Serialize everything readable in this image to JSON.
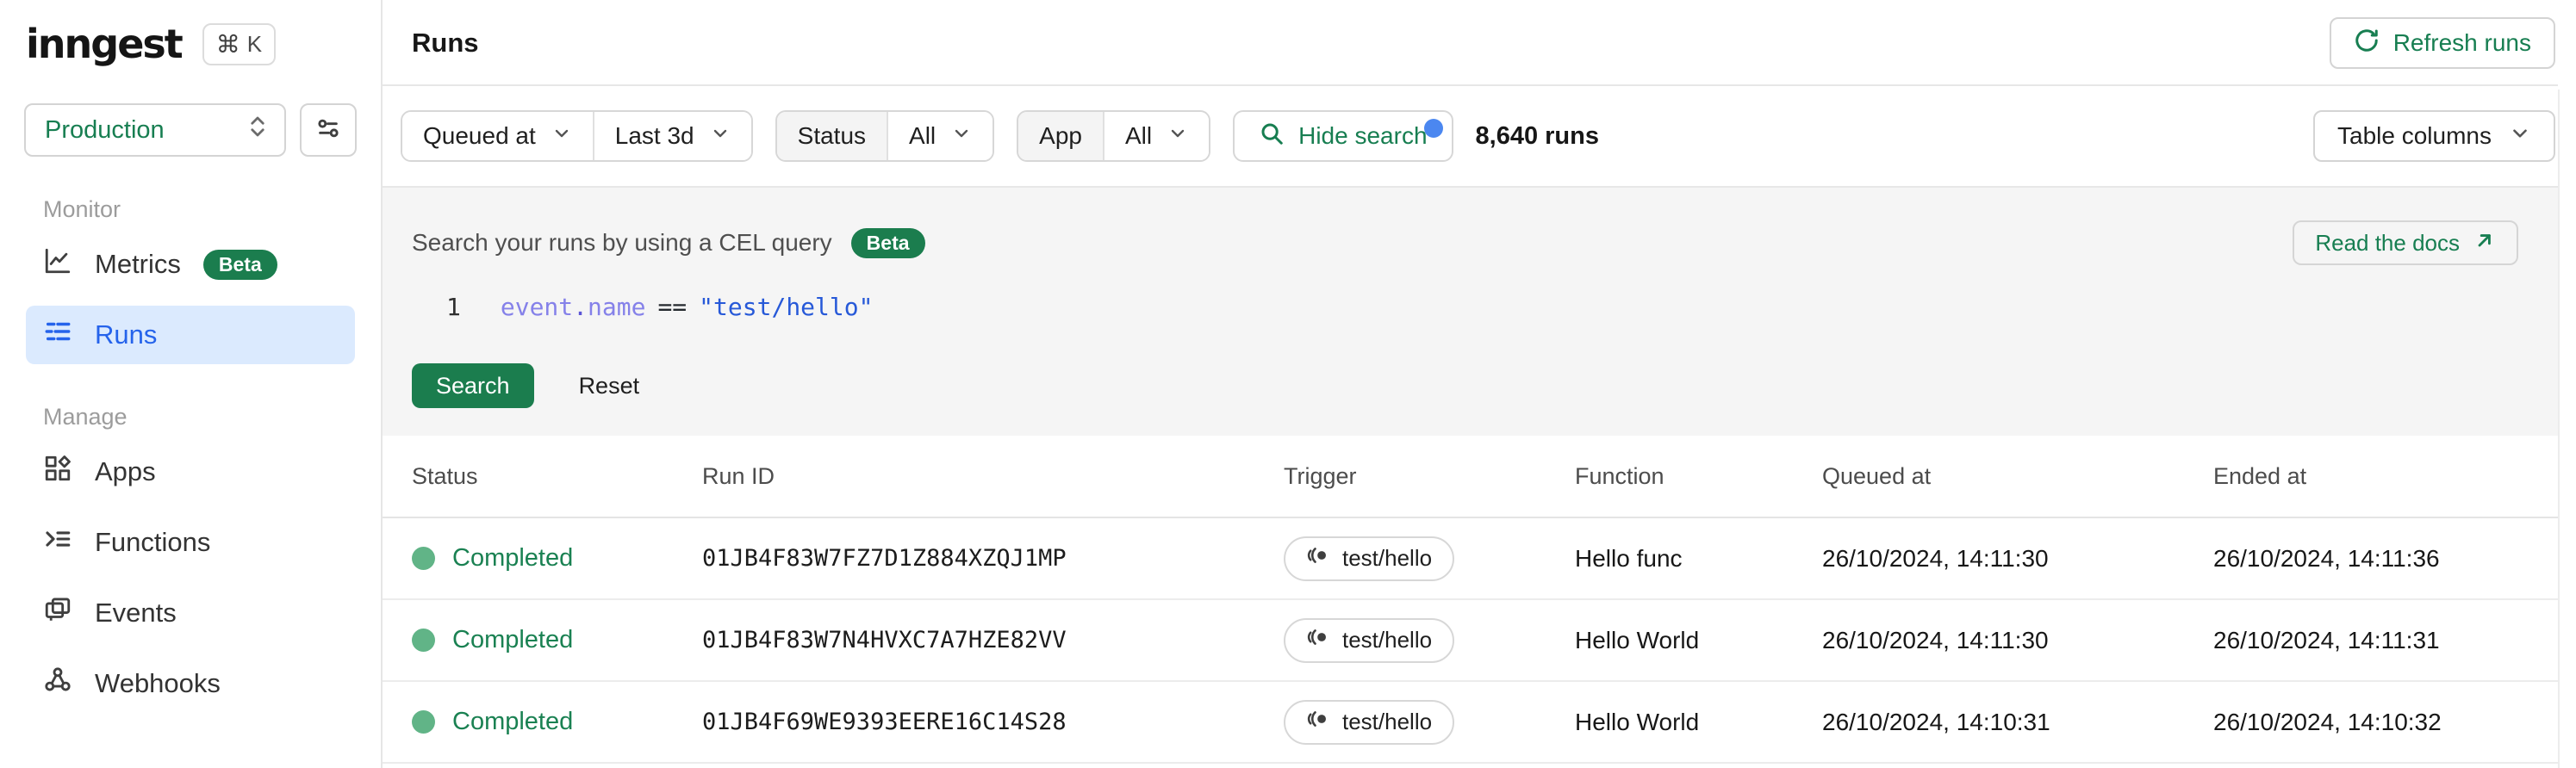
{
  "sidebar": {
    "logo": "inngest",
    "kbd": {
      "modifier": "⌘",
      "key": "K"
    },
    "env_selector": {
      "value": "Production"
    },
    "sections": [
      {
        "label": "Monitor",
        "items": [
          {
            "label": "Metrics",
            "badge": "Beta"
          },
          {
            "label": "Runs"
          }
        ]
      },
      {
        "label": "Manage",
        "items": [
          {
            "label": "Apps"
          },
          {
            "label": "Functions"
          },
          {
            "label": "Events"
          },
          {
            "label": "Webhooks"
          }
        ]
      }
    ]
  },
  "header": {
    "title": "Runs",
    "refresh_label": "Refresh runs"
  },
  "filters": {
    "time_field": "Queued at",
    "time_range": "Last 3d",
    "status_label": "Status",
    "status_value": "All",
    "app_label": "App",
    "app_value": "All",
    "search_toggle_label": "Hide search",
    "runs_count": "8,640 runs",
    "table_columns_label": "Table columns"
  },
  "search_panel": {
    "title": "Search your runs by using a CEL query",
    "beta_badge": "Beta",
    "docs_link": "Read the docs",
    "editor": {
      "line_number": "1",
      "ident1": "event",
      "dot": ".",
      "ident2": "name",
      "operator": "==",
      "string": "\"test/hello\""
    },
    "search_button": "Search",
    "reset_button": "Reset"
  },
  "table": {
    "columns": [
      "Status",
      "Run ID",
      "Trigger",
      "Function",
      "Queued at",
      "Ended at"
    ],
    "rows": [
      {
        "status": "Completed",
        "run_id": "01JB4F83W7FZ7D1Z884XZQJ1MP",
        "trigger": "test/hello",
        "function": "Hello func",
        "queued_at": "26/10/2024, 14:11:30",
        "ended_at": "26/10/2024, 14:11:36"
      },
      {
        "status": "Completed",
        "run_id": "01JB4F83W7N4HVXC7A7HZE82VV",
        "trigger": "test/hello",
        "function": "Hello World",
        "queued_at": "26/10/2024, 14:11:30",
        "ended_at": "26/10/2024, 14:11:31"
      },
      {
        "status": "Completed",
        "run_id": "01JB4F69WE9393EERE16C14S28",
        "trigger": "test/hello",
        "function": "Hello World",
        "queued_at": "26/10/2024, 14:10:31",
        "ended_at": "26/10/2024, 14:10:32"
      }
    ]
  },
  "colors": {
    "brand_green_text": "#177e51",
    "button_green": "#1b7d4e",
    "active_blue": "#2563eb",
    "active_blue_bg": "#dbeafe",
    "status_dot": "#61b487",
    "completed_text": "#1a8152",
    "notification_dot": "#4b87f0",
    "panel_bg": "#f5f5f5",
    "code_ident": "#8581e9",
    "code_string": "#2759d8"
  }
}
